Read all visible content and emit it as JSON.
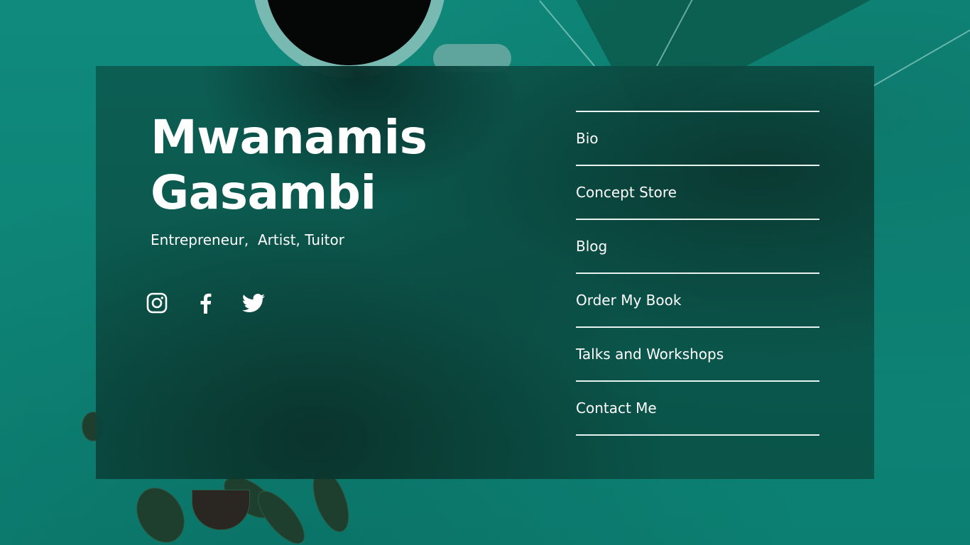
{
  "profile": {
    "name": "Mwanamis Gasambi",
    "tagline": "Entrepreneur,  Artist, Tuitor"
  },
  "socials": [
    {
      "icon": "instagram-icon"
    },
    {
      "icon": "facebook-icon"
    },
    {
      "icon": "twitter-icon"
    }
  ],
  "nav": {
    "items": [
      {
        "label": "Bio"
      },
      {
        "label": "Concept Store"
      },
      {
        "label": "Blog"
      },
      {
        "label": "Order My Book"
      },
      {
        "label": "Talks and Workshops"
      },
      {
        "label": "Contact Me"
      }
    ]
  },
  "colors": {
    "background": "#0f8678",
    "panel": "#0c5c52",
    "text": "#ffffff",
    "divider": "#e8f3f0"
  }
}
